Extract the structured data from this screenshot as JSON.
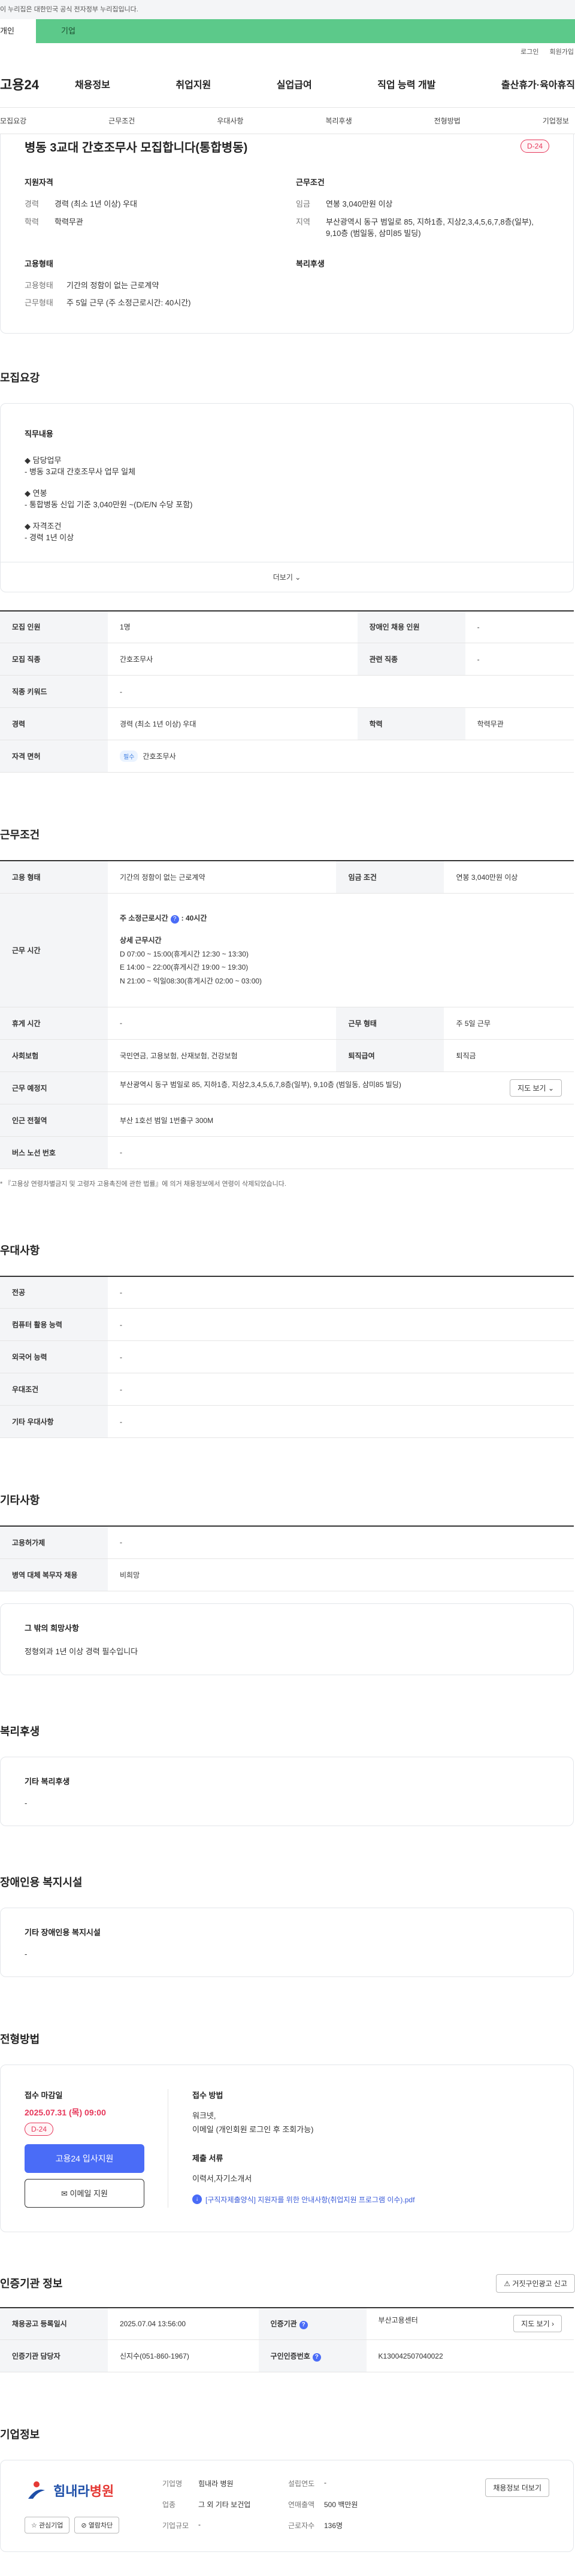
{
  "gov_bar": "이 누리집은 대한민국 공식 전자정부 누리집입니다.",
  "type_tabs": {
    "personal": "개인",
    "company": "기업"
  },
  "util": {
    "login": "로그인",
    "join": "회원가입"
  },
  "gnb": {
    "logo": "고용24",
    "menu": [
      "채용정보",
      "취업지원",
      "실업급여",
      "직업 능력 개발",
      "출산휴가·육아휴직"
    ]
  },
  "anchor_nav": [
    "모집요강",
    "근무조건",
    "우대사항",
    "복리후생",
    "전형방법",
    "기업정보"
  ],
  "summary": {
    "title": "병동 3교대 간호조무사 모집합니다(통합병동)",
    "dday": "D-24",
    "qual_title": "지원자격",
    "qual": [
      {
        "k": "경력",
        "v": "경력 (최소 1년 이상) 우대"
      },
      {
        "k": "학력",
        "v": "학력무관"
      }
    ],
    "work_title": "근무조건",
    "work": [
      {
        "k": "임금",
        "v": "연봉 3,040만원 이상"
      },
      {
        "k": "지역",
        "v": "부산광역시 동구 범일로 85, 지하1층, 지상2,3,4,5,6,7,8층(일부), 9,10층 (범일동, 삼미85 빌딩)"
      }
    ],
    "emp_title": "고용형태",
    "emp": [
      {
        "k": "고용형태",
        "v": "기간의 정함이 없는 근로계약"
      },
      {
        "k": "근무형태",
        "v": "주 5일 근무 (주 소정근로시간: 40시간)"
      }
    ],
    "welfare_title": "복리후생"
  },
  "recruit": {
    "section_title": "모집요강",
    "desc_heading": "직무내용",
    "desc_lines": [
      "◆ 담당업무",
      " - 병동 3교대 간호조무사 업무 일체",
      "",
      "◆ 연봉",
      " - 통합병동 신입 기준 3,040만원 ~(D/E/N 수당 포함)",
      "",
      "◆ 자격조건",
      " - 경력 1년 이상"
    ],
    "more": "더보기",
    "table": {
      "headcount_k": "모집 인원",
      "headcount_v": "1명",
      "disabled_k": "장애인 채용 인원",
      "disabled_v": "-",
      "job_k": "모집 직종",
      "job_v": "간호조무사",
      "related_k": "관련 직종",
      "related_v": "-",
      "keyword_k": "직종 키워드",
      "keyword_v": "-",
      "career_k": "경력",
      "career_v": "경력 (최소 1년 이상) 우대",
      "edu_k": "학력",
      "edu_v": "학력무관",
      "license_k": "자격 면허",
      "license_badge": "필수",
      "license_v": "간호조무사"
    }
  },
  "conditions": {
    "section_title": "근무조건",
    "emp_k": "고용 형태",
    "emp_v": "기간의 정함이 없는 근로계약",
    "wage_k": "임금 조건",
    "wage_v": "연봉 3,040만원 이상",
    "hours_k": "근무 시간",
    "weekly_label": "주 소정근로시간",
    "weekly_value": ": 40시간",
    "detail_label": "상세 근무시간",
    "detail_lines": [
      "D 07:00 ~ 15:00(휴게시간 12:30 ~ 13:30)",
      "E 14:00 ~ 22:00(휴게시간 19:00 ~ 19:30)",
      "N 21:00 ~ 익일08:30(휴게시간 02:00 ~ 03:00)"
    ],
    "break_k": "휴게 시간",
    "break_v": "-",
    "work_type_k": "근무 형태",
    "work_type_v": "주 5일 근무",
    "insurance_k": "사회보험",
    "insurance_v": "국민연금, 고용보험, 산재보험, 건강보험",
    "retire_k": "퇴직급여",
    "retire_v": "퇴직금",
    "location_k": "근무 예정지",
    "location_v": "부산광역시 동구 범일로 85, 지하1층, 지상2,3,4,5,6,7,8층(일부), 9,10층 (범일동, 삼미85 빌딩)",
    "map_btn": "지도 보기",
    "subway_k": "인근 전철역",
    "subway_v": "부산 1호선 범일 1번출구 300M",
    "bus_k": "버스 노선 번호",
    "bus_v": "-",
    "note": "* 『고용상 연령차별금지 및 고령자 고용촉진에 관한 법률』에 의거 채용정보에서 연령이 삭제되었습니다."
  },
  "preference": {
    "section_title": "우대사항",
    "rows": [
      {
        "k": "전공",
        "v": "-"
      },
      {
        "k": "컴퓨터 활용 능력",
        "v": "-"
      },
      {
        "k": "외국어 능력",
        "v": "-"
      },
      {
        "k": "우대조건",
        "v": "-"
      },
      {
        "k": "기타 우대사항",
        "v": "-"
      }
    ]
  },
  "etc": {
    "section_title": "기타사항",
    "rows": [
      {
        "k": "고용허가제",
        "v": "-"
      },
      {
        "k": "병역 대체 복무자 채용",
        "v": "비희망"
      }
    ],
    "box_title": "그 밖의 희망사항",
    "box_text": "정형외과 1년 이상 경력 필수입니다"
  },
  "welfare": {
    "section_title": "복리후생",
    "box_title": "기타 복리후생",
    "box_text": "-"
  },
  "disabled_fac": {
    "section_title": "장애인용 복지시설",
    "box_title": "기타 장애인용 복지시설",
    "box_text": "-"
  },
  "apply": {
    "section_title": "전형방법",
    "deadline_label": "접수 마감일",
    "deadline": "2025.07.31 (목) 09:00",
    "dday": "D-24",
    "apply_btn": "고용24 입사지원",
    "email_btn": "이메일 지원",
    "method_title": "접수 방법",
    "method_lines": [
      "워크넷,",
      "이메일 (개인회원 로그인 후 조회가능)"
    ],
    "docs_title": "제출 서류",
    "docs_text": "이력서,자기소개서",
    "file_link": "[구직자제출양식] 지원자를 위한 안내사항(취업지원 프로그램 이수).pdf"
  },
  "cert": {
    "section_title": "인증기관 정보",
    "report_btn": "거짓구인광고 신고",
    "reg_date_k": "채용공고 등록일시",
    "reg_date_v": "2025.07.04 13:56:00",
    "agency_k": "인증기관",
    "agency_v": "부산고용센터",
    "map_btn": "지도 보기",
    "manager_k": "인증기관 담당자",
    "manager_v": "신지수(051-860-1967)",
    "id_k": "구인인증번호",
    "id_v": "K130042507040022"
  },
  "company": {
    "section_title": "기업정보",
    "logo_main": "힘내라",
    "logo_sub": "병원",
    "interest_btn": "관심기업",
    "block_btn": "열람차단",
    "name_k": "기업명",
    "name_v": "힘내라 병원",
    "founded_k": "설립연도",
    "founded_v": "-",
    "industry_k": "업종",
    "industry_v": "그 외 기타 보건업",
    "revenue_k": "연매출액",
    "revenue_v": "500 백만원",
    "size_k": "기업규모",
    "size_v": "-",
    "staff_k": "근로자수",
    "staff_v": "136명",
    "more_btn": "채용정보 더보기"
  }
}
